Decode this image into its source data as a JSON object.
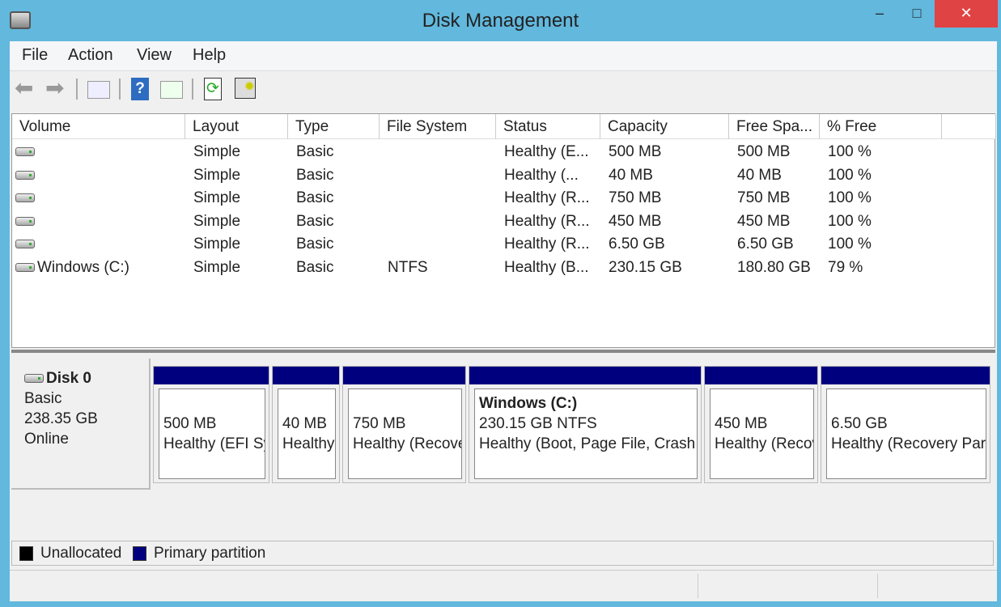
{
  "window": {
    "title": "Disk Management",
    "minimize": "–",
    "maximize": "□",
    "close": "✕",
    "close_color": "#e04343"
  },
  "menu": [
    "File",
    "Action",
    "View",
    "Help"
  ],
  "toolbar": [
    "back-icon",
    "forward-icon",
    "show-hide-console-tree-icon",
    "help-icon",
    "show-hide-action-pane-icon",
    "refresh-icon",
    "properties-icon"
  ],
  "table": {
    "columns": [
      "Volume",
      "Layout",
      "Type",
      "File System",
      "Status",
      "Capacity",
      "Free Spa...",
      "% Free"
    ],
    "rows": [
      [
        "",
        "Simple",
        "Basic",
        "",
        "Healthy (E...",
        "500 MB",
        "500 MB",
        "100 %"
      ],
      [
        "",
        "Simple",
        "Basic",
        "",
        "Healthy (...",
        "40 MB",
        "40 MB",
        "100 %"
      ],
      [
        "",
        "Simple",
        "Basic",
        "",
        "Healthy (R...",
        "750 MB",
        "750 MB",
        "100 %"
      ],
      [
        "",
        "Simple",
        "Basic",
        "",
        "Healthy (R...",
        "450 MB",
        "450 MB",
        "100 %"
      ],
      [
        "",
        "Simple",
        "Basic",
        "",
        "Healthy (R...",
        "6.50 GB",
        "6.50 GB",
        "100 %"
      ],
      [
        "Windows (C:)",
        "Simple",
        "Basic",
        "NTFS",
        "Healthy (B...",
        "230.15 GB",
        "180.80 GB",
        "79 %"
      ]
    ]
  },
  "disk": {
    "name": "Disk 0",
    "type": "Basic",
    "size": "238.35 GB",
    "state": "Online",
    "partitions": [
      {
        "title": "",
        "size": "500 MB",
        "status": "Healthy (EFI System Partition)"
      },
      {
        "title": "",
        "size": "40 MB",
        "status": "Healthy (OEM Partition)"
      },
      {
        "title": "",
        "size": "750 MB",
        "status": "Healthy (Recovery Partition)"
      },
      {
        "title": "Windows  (C:)",
        "size": "230.15 GB NTFS",
        "status": "Healthy (Boot, Page File, Crash Dump, Primary Partition)"
      },
      {
        "title": "",
        "size": "450 MB",
        "status": "Healthy (Recovery Partition)"
      },
      {
        "title": "",
        "size": "6.50 GB",
        "status": "Healthy (Recovery Partition)"
      }
    ]
  },
  "legend": [
    {
      "label": "Unallocated",
      "color": "#000000"
    },
    {
      "label": "Primary partition",
      "color": "#00007f"
    }
  ]
}
